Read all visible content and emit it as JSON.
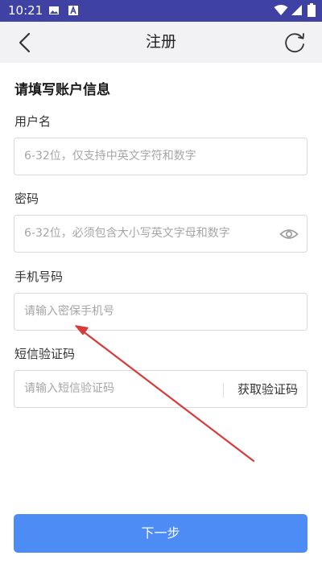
{
  "status_bar": {
    "time": "10:21",
    "icons": [
      "image-icon",
      "a-icon",
      "wifi-icon",
      "signal-icon",
      "battery-icon"
    ]
  },
  "nav": {
    "title": "注册",
    "back_icon": "chevron-left-icon",
    "refresh_icon": "refresh-icon"
  },
  "form": {
    "section_title": "请填写账户信息",
    "username": {
      "label": "用户名",
      "placeholder": "6-32位，仅支持中英文字符和数字"
    },
    "password": {
      "label": "密码",
      "placeholder": "6-32位，必须包含大小写英文字母和数字",
      "toggle_icon": "eye-icon"
    },
    "phone": {
      "label": "手机号码",
      "placeholder": "请输入密保手机号"
    },
    "sms_code": {
      "label": "短信验证码",
      "placeholder": "请输入短信验证码",
      "get_code_label": "获取验证码"
    }
  },
  "next_button": "下一步",
  "colors": {
    "status_bar": "#3F41A3",
    "nav_bar": "#F2F2F4",
    "primary_button": "#4D8CF5",
    "annotation_arrow": "#D93A3A"
  }
}
